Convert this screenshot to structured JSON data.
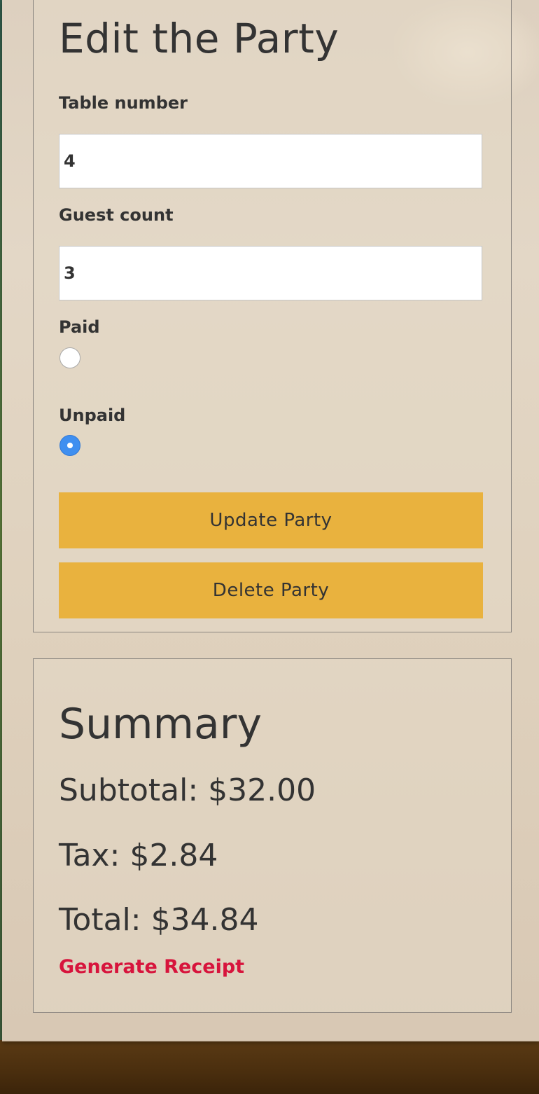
{
  "edit_form": {
    "title": "Edit the Party",
    "table_number": {
      "label": "Table number",
      "value": "4"
    },
    "guest_count": {
      "label": "Guest count",
      "value": "3"
    },
    "paid_status": {
      "options": [
        {
          "label": "Paid",
          "selected": false
        },
        {
          "label": "Unpaid",
          "selected": true
        }
      ]
    },
    "update_button": "Update Party",
    "delete_button": "Delete Party"
  },
  "summary": {
    "title": "Summary",
    "subtotal": "Subtotal: $32.00",
    "tax": "Tax: $2.84",
    "total": "Total: $34.84",
    "receipt_link": "Generate Receipt"
  },
  "colors": {
    "button": "#e9b23e",
    "link": "#d7143c",
    "radio_selected": "#3f8ff0",
    "text": "#333333"
  }
}
